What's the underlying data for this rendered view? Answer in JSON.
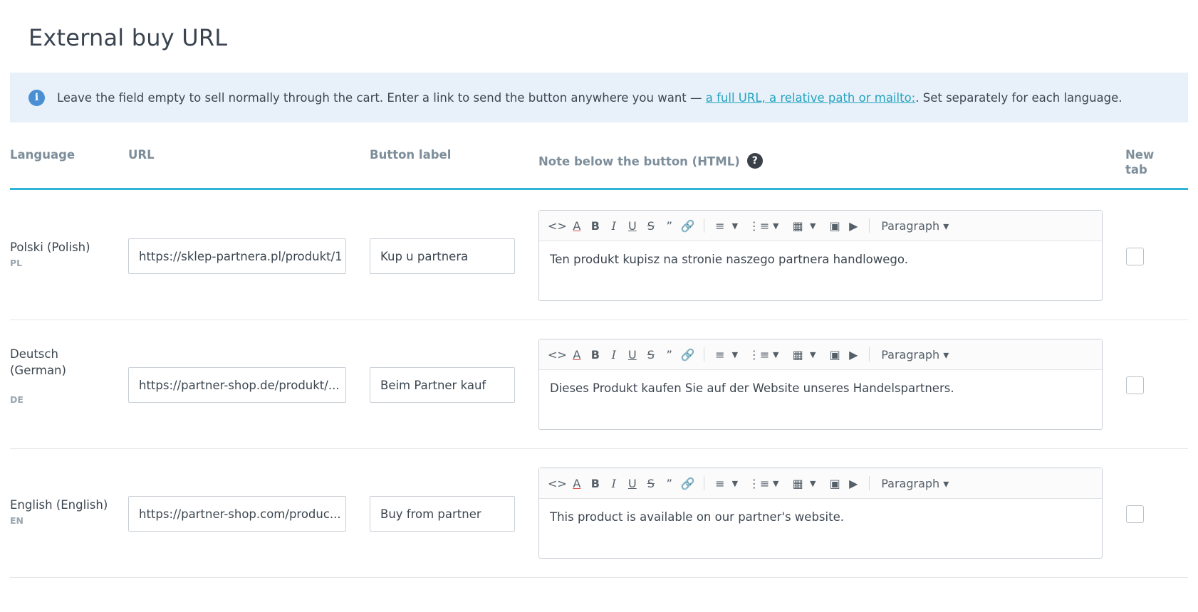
{
  "page": {
    "title": "External buy URL"
  },
  "info": {
    "text_before": "Leave the field empty to sell normally through the cart. Enter a link to send the button anywhere you want — ",
    "link": "a full URL, a relative path or mailto:",
    "text_after": ". Set separately for each language."
  },
  "table": {
    "headers": {
      "language": "Language",
      "url": "URL",
      "label": "Button label",
      "note": "Note below the button (HTML)",
      "note_help": "?",
      "newtab_line1": "New",
      "newtab_line2": "tab"
    },
    "toolbar": {
      "paragraph": "Paragraph ▾"
    },
    "rows": [
      {
        "lang_name": "Polski (Polish)",
        "lang_code": "PL",
        "url": "https://sklep-partnera.pl/produkt/1",
        "label": "Kup u partnera",
        "note": "Ten produkt kupisz na stronie naszego partnera handlowego.",
        "new_tab": false
      },
      {
        "lang_name": "Deutsch (German)",
        "lang_code": "DE",
        "url": "https://partner-shop.de/produkt/...",
        "label": "Beim Partner kauf",
        "note": "Dieses Produkt kaufen Sie auf der Website unseres Handelspartners.",
        "new_tab": false
      },
      {
        "lang_name": "English (English)",
        "lang_code": "EN",
        "url": "https://partner-shop.com/produc...",
        "label": "Buy from partner",
        "note": "This product is available on our partner's website.",
        "new_tab": false
      }
    ]
  }
}
